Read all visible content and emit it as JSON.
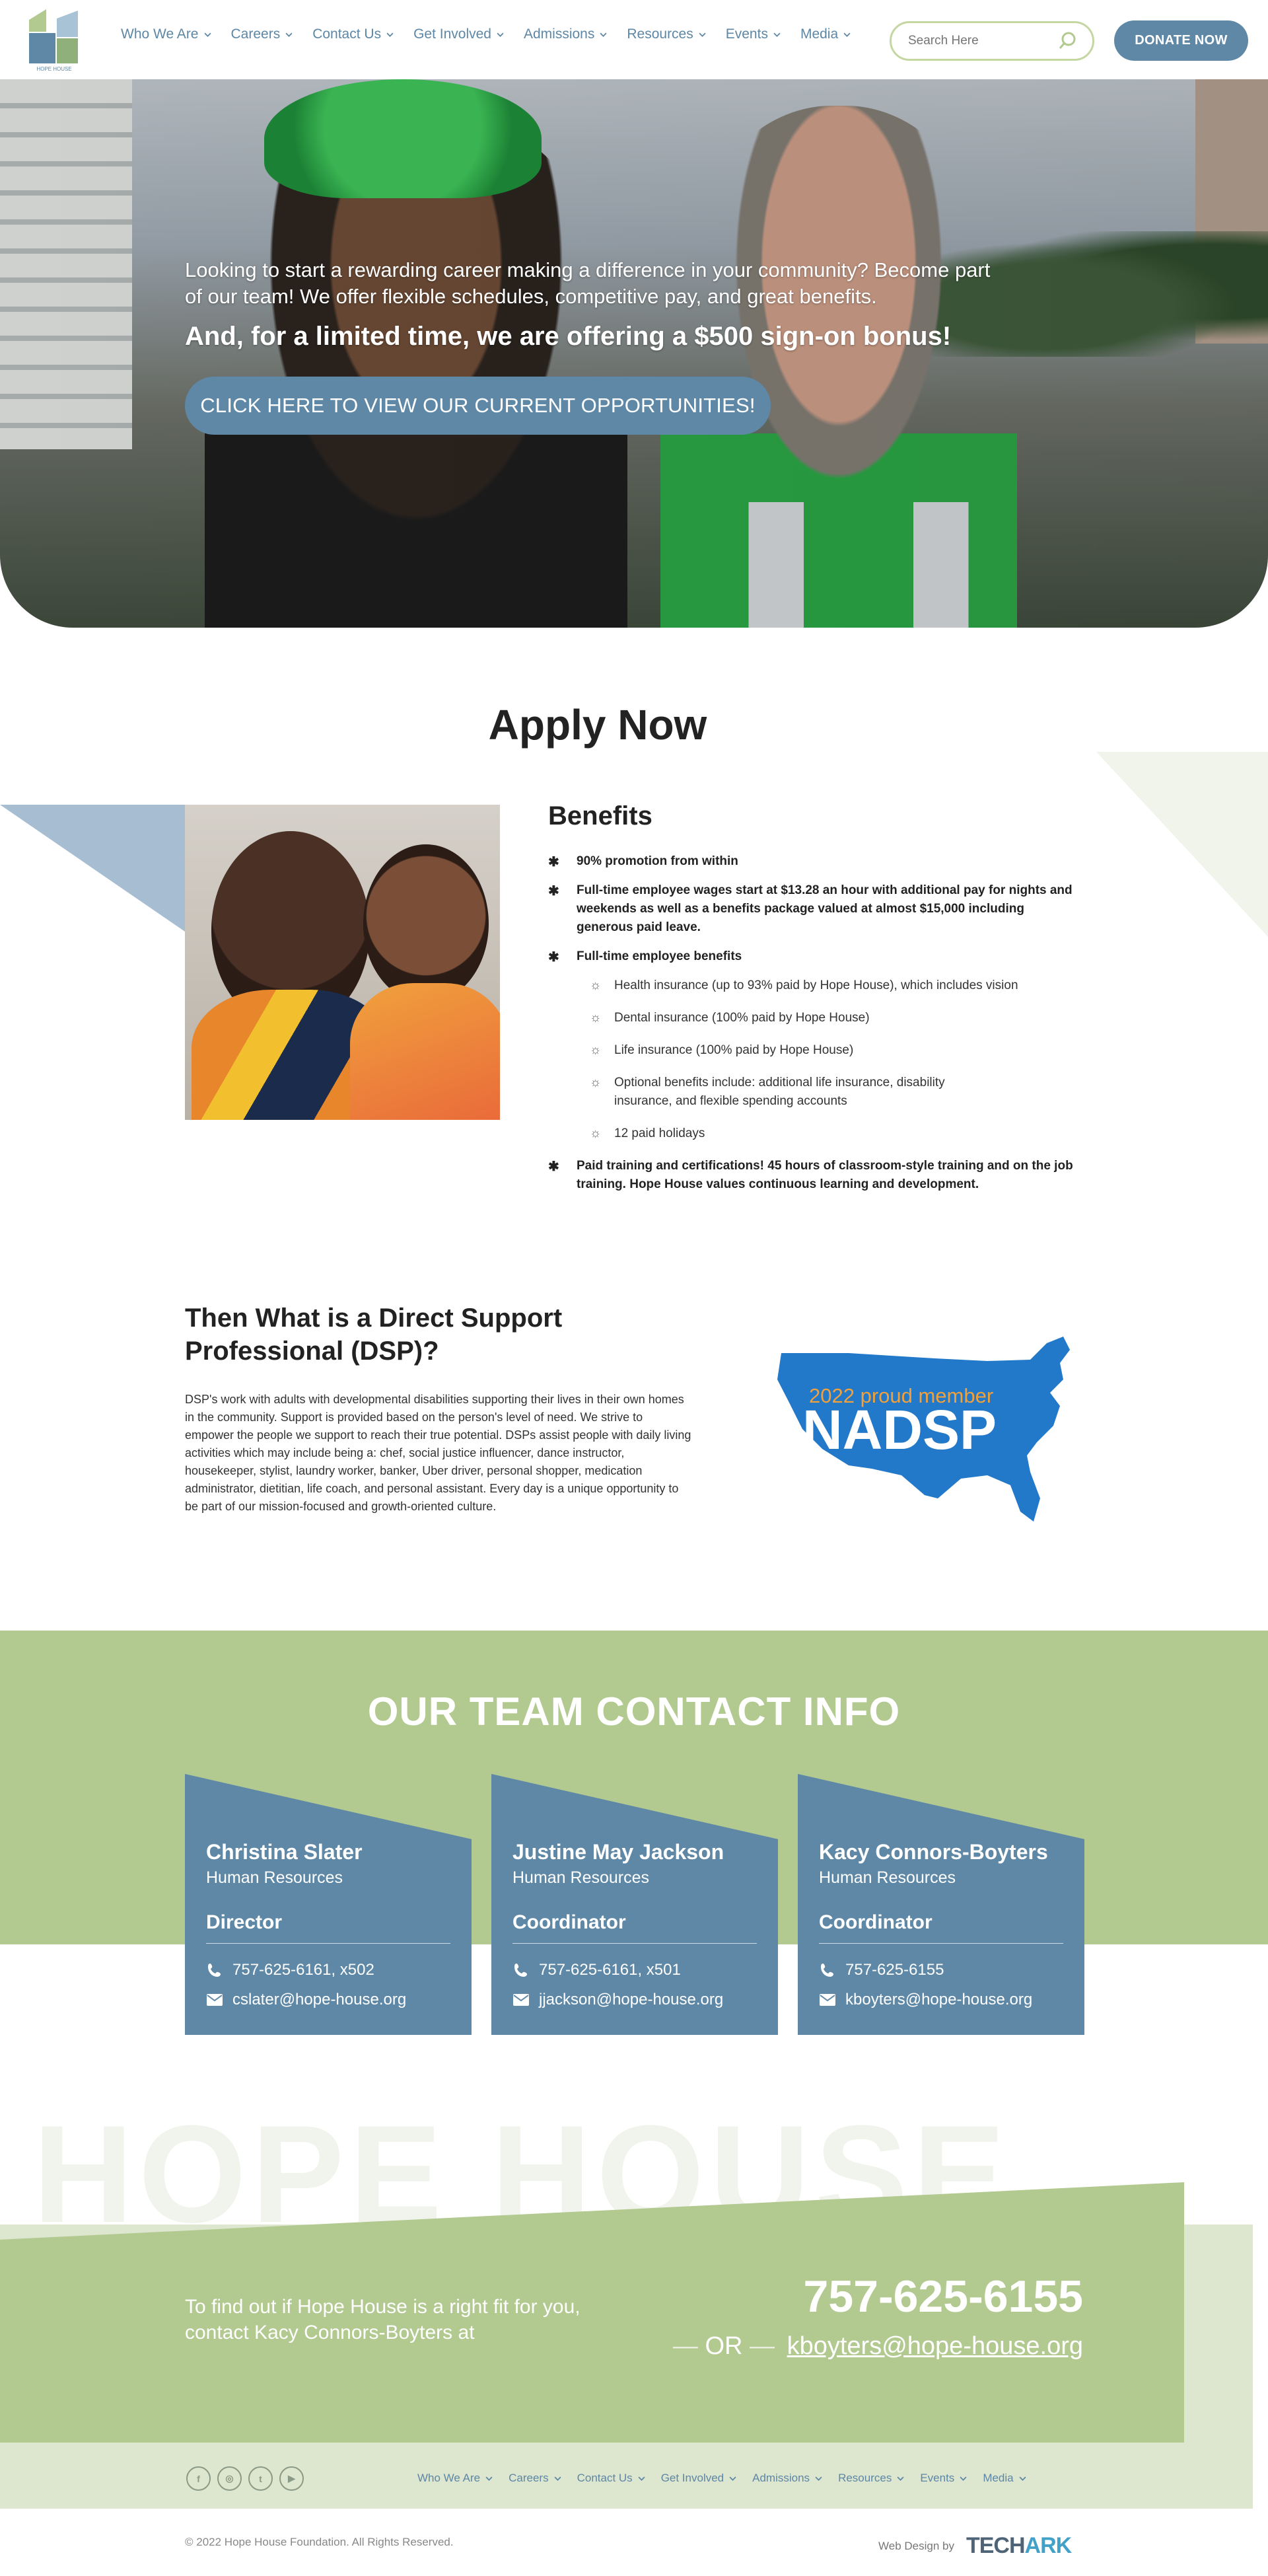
{
  "header": {
    "logo_text": "HOPE HOUSE",
    "nav": [
      "Who We Are",
      "Careers",
      "Contact Us",
      "Get Involved",
      "Admissions",
      "Resources",
      "Events",
      "Media"
    ],
    "search_placeholder": "Search Here",
    "donate_label": "DONATE NOW"
  },
  "hero": {
    "intro": "Looking to start a rewarding career making a difference in your community?  Become part of our team!  We offer flexible schedules, competitive pay, and great benefits.",
    "bonus": "And, for a limited time, we are offering a $500 sign-on bonus!",
    "cta_label": "CLICK HERE TO VIEW OUR CURRENT OPPORTUNITIES!"
  },
  "apply": {
    "title": "Apply Now",
    "benefits_title": "Benefits",
    "benefits": [
      "90% promotion from within",
      "Full-time employee wages start at $13.28 an hour with additional pay for nights and weekends as well as a benefits package valued at almost $15,000 including generous paid leave.",
      "Full-time employee benefits"
    ],
    "sub_benefits": [
      "Health insurance (up to 93% paid by Hope House), which includes vision",
      "Dental insurance (100% paid by Hope House)",
      "Life insurance (100% paid by Hope House)",
      "Optional benefits include:  additional life insurance, disability insurance, and flexible spending accounts",
      "12 paid holidays"
    ],
    "last_benefit": "Paid training and certifications!  45 hours of classroom-style training and on the job training.  Hope House values continuous learning and development."
  },
  "dsp": {
    "title": "Then What is a Direct Support Professional (DSP)?",
    "body": "DSP's work with adults with developmental disabilities supporting their lives in their own homes in the community. Support is provided based on the person's level of need. We strive to empower the people we support to reach their true potential. DSPs assist people with daily living activities which may include being a: chef, social justice influencer, dance instructor, housekeeper, stylist, laundry worker, banker, Uber driver, personal shopper, medication administrator, dietitian, life coach, and personal assistant. Every day is a unique opportunity to be part of our mission-focused and growth-oriented culture.",
    "badge_year": "2022 proud member",
    "badge_name": "NADSP"
  },
  "team": {
    "title": "OUR TEAM CONTACT INFO",
    "cards": [
      {
        "name": "Christina Slater",
        "dept": "Human Resources",
        "role": "Director",
        "phone": "757-625-6161, x502",
        "email": "cslater@hope-house.org"
      },
      {
        "name": "Justine May Jackson",
        "dept": "Human Resources",
        "role": "Coordinator",
        "phone": "757-625-6161, x501",
        "email": "jjackson@hope-house.org"
      },
      {
        "name": "Kacy Connors-Boyters",
        "dept": "Human Resources",
        "role": "Coordinator",
        "phone": "757-625-6155",
        "email": "kboyters@hope-house.org"
      }
    ]
  },
  "cta": {
    "ghost": "HOPE HOUSE",
    "text": "To find out if Hope House is a right fit for you, contact Kacy Connors-Boyters at",
    "phone": "757-625-6155",
    "or": "OR",
    "email": "kboyters@hope-house.org"
  },
  "footer": {
    "socials": [
      "f",
      "◎",
      "t",
      "▶"
    ],
    "nav": [
      "Who We Are",
      "Careers",
      "Contact Us",
      "Get Involved",
      "Admissions",
      "Resources",
      "Events",
      "Media"
    ],
    "copyright": "© 2022 Hope House Foundation. All Rights Reserved.",
    "web_design": "Web Design by",
    "agency_a": "TECH",
    "agency_b": "ARK"
  },
  "colors": {
    "brand_blue": "#5f88a6",
    "brand_green": "#b2c990",
    "light_green": "#dde6cf"
  },
  "icons": [
    "logo-house-icon",
    "chevron-down-icon",
    "search-icon",
    "phone-icon",
    "email-icon",
    "facebook-icon",
    "instagram-icon",
    "twitter-icon",
    "youtube-icon",
    "star-bullet-icon",
    "sun-bullet-icon"
  ]
}
